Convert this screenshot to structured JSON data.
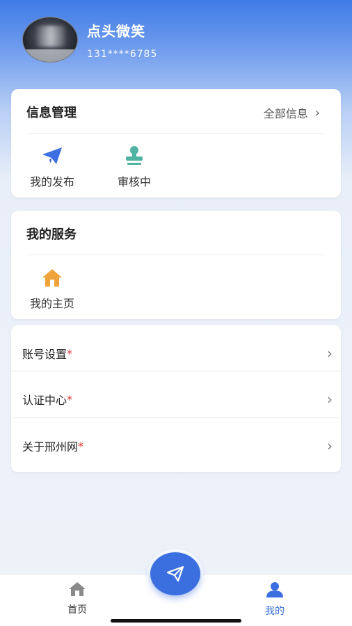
{
  "profile": {
    "name": "点头微笑",
    "phone": "131****6785"
  },
  "info_card": {
    "title": "信息管理",
    "all_link": "全部信息",
    "items": [
      {
        "label": "我的发布",
        "icon": "paper-plane-icon"
      },
      {
        "label": "审核中",
        "icon": "stamp-icon"
      }
    ]
  },
  "service_card": {
    "title": "我的服务",
    "items": [
      {
        "label": "我的主页",
        "icon": "home-icon"
      }
    ]
  },
  "menu": {
    "items": [
      {
        "label": "账号设置",
        "mark": "*"
      },
      {
        "label": "认证中心",
        "mark": "*"
      },
      {
        "label": "关于邢州网",
        "mark": "*"
      }
    ]
  },
  "tabbar": {
    "home": "首页",
    "mine": "我的",
    "active": "mine",
    "colors": {
      "active": "#3b6fe0",
      "inactive": "#888888"
    }
  },
  "colors": {
    "accent": "#3b6fe0",
    "plane": "#3d6fe0",
    "stamp": "#4fb4a2",
    "home": "#f0a23b",
    "asterisk": "#e0312b"
  }
}
